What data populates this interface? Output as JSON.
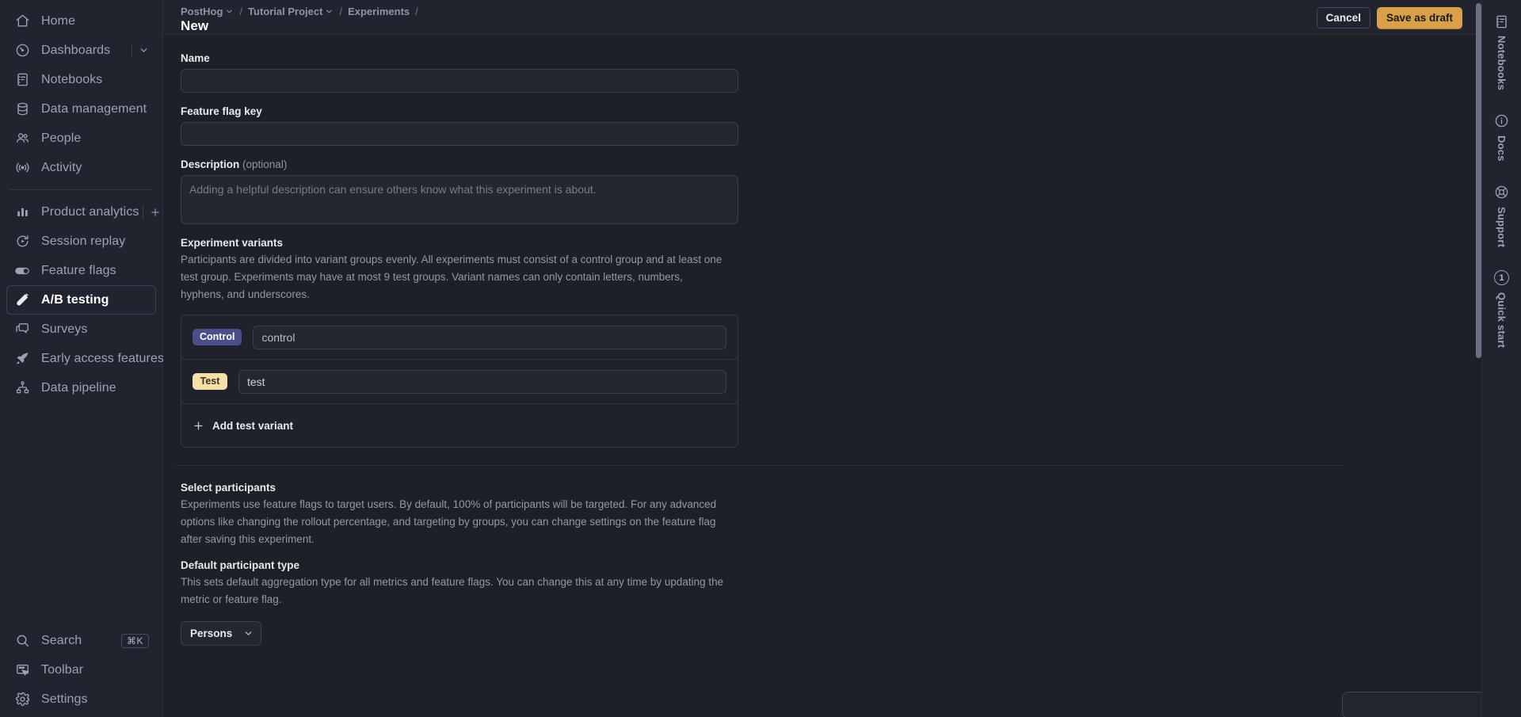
{
  "sidebar": {
    "primary_items": [
      {
        "label": "Home",
        "icon": "home-icon"
      },
      {
        "label": "Dashboards",
        "icon": "gauge-icon",
        "extra": "chevron-down-icon"
      },
      {
        "label": "Notebooks",
        "icon": "notebook-icon"
      },
      {
        "label": "Data management",
        "icon": "database-icon"
      },
      {
        "label": "People",
        "icon": "people-icon"
      },
      {
        "label": "Activity",
        "icon": "activity-icon"
      }
    ],
    "secondary_items": [
      {
        "label": "Product analytics",
        "icon": "bar-chart-icon",
        "extra": "plus-icon"
      },
      {
        "label": "Session replay",
        "icon": "replay-icon"
      },
      {
        "label": "Feature flags",
        "icon": "toggle-icon"
      },
      {
        "label": "A/B testing",
        "icon": "flask-icon",
        "active": true
      },
      {
        "label": "Surveys",
        "icon": "comment-icon"
      },
      {
        "label": "Early access features",
        "icon": "rocket-icon"
      },
      {
        "label": "Data pipeline",
        "icon": "pipeline-icon"
      }
    ],
    "bottom_items": [
      {
        "label": "Search",
        "icon": "search-icon",
        "shortcut": "⌘K"
      },
      {
        "label": "Toolbar",
        "icon": "toolbar-icon"
      },
      {
        "label": "Settings",
        "icon": "gear-icon"
      }
    ]
  },
  "topbar": {
    "breadcrumbs": [
      {
        "label": "PostHog",
        "has_chevron": true
      },
      {
        "label": "Tutorial Project",
        "has_chevron": true
      },
      {
        "label": "Experiments",
        "has_chevron": false
      }
    ],
    "page_title": "New",
    "cancel_label": "Cancel",
    "save_label": "Save as draft"
  },
  "form": {
    "name": {
      "label": "Name",
      "value": "",
      "placeholder": ""
    },
    "feature_flag_key": {
      "label": "Feature flag key",
      "value": "",
      "placeholder": ""
    },
    "description": {
      "label": "Description",
      "optional_suffix": "(optional)",
      "value": "",
      "placeholder": "Adding a helpful description can ensure others know what this experiment is about."
    },
    "variants": {
      "title": "Experiment variants",
      "description": "Participants are divided into variant groups evenly. All experiments must consist of a control group and at least one test group. Experiments may have at most 9 test groups. Variant names can only contain letters, numbers, hyphens, and underscores.",
      "rows": [
        {
          "badge": "Control",
          "value": "control",
          "badge_type": "control"
        },
        {
          "badge": "Test",
          "value": "test",
          "badge_type": "test"
        }
      ],
      "add_label": "Add test variant"
    },
    "participants": {
      "title": "Select participants",
      "description": "Experiments use feature flags to target users. By default, 100% of participants will be targeted. For any advanced options like changing the rollout percentage, and targeting by groups, you can change settings on the feature flag after saving this experiment."
    },
    "participant_type": {
      "title": "Default participant type",
      "description": "This sets default aggregation type for all metrics and feature flags. You can change this at any time by updating the metric or feature flag.",
      "selected": "Persons"
    }
  },
  "right_rail": {
    "items": [
      {
        "label": "Notebooks",
        "icon": "notebook-icon",
        "badge": null
      },
      {
        "label": "Docs",
        "icon": "info-icon",
        "badge": null
      },
      {
        "label": "Support",
        "icon": "support-icon",
        "badge": null
      },
      {
        "label": "Quick start",
        "icon": "number-badge",
        "badge": "1"
      }
    ]
  },
  "colors": {
    "accent": "#d9a04a",
    "control_badge": "#4a4f8c",
    "test_badge": "#f6dfa8",
    "sidebar_bg": "#21242e",
    "content_bg": "#1d2027"
  }
}
